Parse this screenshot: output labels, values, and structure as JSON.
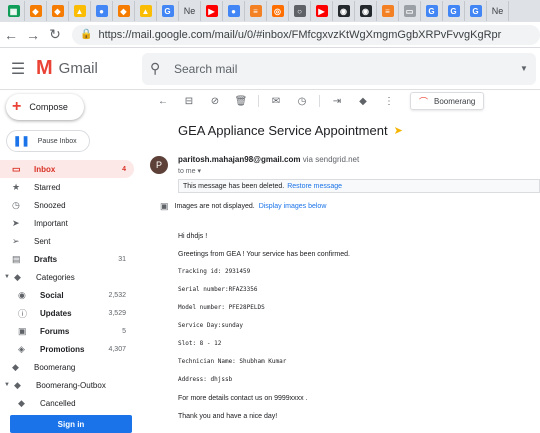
{
  "browser": {
    "tabs": [
      {
        "name": "tab-sheets",
        "glyph": "▦",
        "color": "#0f9d58"
      },
      {
        "name": "tab-orange-1",
        "glyph": "◆",
        "color": "#f57c00"
      },
      {
        "name": "tab-orange-2",
        "glyph": "◆",
        "color": "#f57c00"
      },
      {
        "name": "tab-drive",
        "glyph": "▲",
        "color": "#fbbc04"
      },
      {
        "name": "tab-multi-1",
        "glyph": "●",
        "color": "#4285f4"
      },
      {
        "name": "tab-orange-3",
        "glyph": "◆",
        "color": "#f57c00"
      },
      {
        "name": "tab-drive-2",
        "glyph": "▲",
        "color": "#fbbc04"
      },
      {
        "name": "tab-google-1",
        "glyph": "G",
        "color": "#4285f4"
      },
      {
        "name": "tab-ne-1",
        "glyph": "Ne",
        "color": "#5f6368",
        "is_text": true
      },
      {
        "name": "tab-youtube-1",
        "glyph": "▶",
        "color": "#ff0000"
      },
      {
        "name": "tab-multi-2",
        "glyph": "●",
        "color": "#4285f4"
      },
      {
        "name": "tab-stack",
        "glyph": "≡",
        "color": "#f48024"
      },
      {
        "name": "tab-odd",
        "glyph": "◎",
        "color": "#ff6f00"
      },
      {
        "name": "tab-circle",
        "glyph": "○",
        "color": "#5f6368"
      },
      {
        "name": "tab-youtube-2",
        "glyph": "▶",
        "color": "#ff0000"
      },
      {
        "name": "tab-github-1",
        "glyph": "◉",
        "color": "#24292e"
      },
      {
        "name": "tab-github-2",
        "glyph": "◉",
        "color": "#24292e"
      },
      {
        "name": "tab-stack-2",
        "glyph": "≡",
        "color": "#f48024"
      },
      {
        "name": "tab-gray",
        "glyph": "▭",
        "color": "#9aa0a6"
      },
      {
        "name": "tab-google-2",
        "glyph": "G",
        "color": "#4285f4"
      },
      {
        "name": "tab-google-3",
        "glyph": "G",
        "color": "#4285f4"
      },
      {
        "name": "tab-google-4",
        "glyph": "G",
        "color": "#4285f4"
      },
      {
        "name": "tab-ne-2",
        "glyph": "Ne",
        "color": "#5f6368",
        "is_text": true
      }
    ],
    "url": "https://mail.google.com/mail/u/0/#inbox/FMfcgxvzKtWgXmgmGgbXRPvFvvgKgRpr"
  },
  "gmail": {
    "app_name": "Gmail",
    "search_placeholder": "Search mail"
  },
  "sidebar": {
    "compose_label": "Compose",
    "pause_label": "Pause Inbox",
    "items": [
      {
        "name": "sidebar-item-inbox",
        "icon": "inbox-icon",
        "glyph": "▭",
        "label": "Inbox",
        "count": "4",
        "active": true
      },
      {
        "name": "sidebar-item-starred",
        "icon": "star-icon",
        "glyph": "★",
        "label": "Starred",
        "count": ""
      },
      {
        "name": "sidebar-item-snoozed",
        "icon": "clock-icon",
        "glyph": "◷",
        "label": "Snoozed",
        "count": ""
      },
      {
        "name": "sidebar-item-important",
        "icon": "important-icon",
        "glyph": "➤",
        "label": "Important",
        "count": ""
      },
      {
        "name": "sidebar-item-sent",
        "icon": "send-icon",
        "glyph": "➢",
        "label": "Sent",
        "count": ""
      },
      {
        "name": "sidebar-item-drafts",
        "icon": "draft-icon",
        "glyph": "▤",
        "label": "Drafts",
        "count": "31",
        "bold": true
      },
      {
        "name": "sidebar-item-categories",
        "icon": "label-icon",
        "glyph": "◆",
        "label": "Categories",
        "count": "",
        "caret": true
      },
      {
        "name": "sidebar-item-social",
        "icon": "people-icon",
        "glyph": "◉",
        "label": "Social",
        "count": "2,532",
        "bold": true,
        "sub": true
      },
      {
        "name": "sidebar-item-updates",
        "icon": "info-icon",
        "glyph": "ⓘ",
        "label": "Updates",
        "count": "3,529",
        "bold": true,
        "sub": true
      },
      {
        "name": "sidebar-item-forums",
        "icon": "forum-icon",
        "glyph": "▣",
        "label": "Forums",
        "count": "5",
        "bold": true,
        "sub": true
      },
      {
        "name": "sidebar-item-promotions",
        "icon": "tag-icon",
        "glyph": "◈",
        "label": "Promotions",
        "count": "4,307",
        "bold": true,
        "sub": true
      },
      {
        "name": "sidebar-item-boomerang",
        "icon": "label-icon",
        "glyph": "◆",
        "label": "Boomerang",
        "count": ""
      },
      {
        "name": "sidebar-item-boomerang-outbox",
        "icon": "label-icon",
        "glyph": "◆",
        "label": "Boomerang-Outbox",
        "count": "",
        "caret": true
      },
      {
        "name": "sidebar-item-cancelled",
        "icon": "label-icon",
        "glyph": "◆",
        "label": "Cancelled",
        "count": "",
        "sub": true
      }
    ],
    "signin_label": "Sign in"
  },
  "toolbar": {
    "boomerang_label": "Boomerang"
  },
  "message": {
    "subject": "GEA Appliance Service Appointment",
    "avatar_initial": "P",
    "sender_email": "paritosh.mahajan98@gmail.com",
    "via_text": "via sendgrid.net",
    "to_text": "to me ▾",
    "deleted_notice": "This message has been deleted.",
    "restore_link": "Restore message",
    "images_notice": "Images are not displayed.",
    "images_link": "Display images below",
    "body_lines": [
      {
        "text": "Hi dhdjs !",
        "mono": false
      },
      {
        "text": "Greetings from GEA ! Your service has been confirmed.",
        "mono": false
      },
      {
        "text": "Tracking id: 2931459",
        "mono": true
      },
      {
        "text": "Serial number:RFAZ3356",
        "mono": true
      },
      {
        "text": "Model number: PFE28PELDS",
        "mono": true
      },
      {
        "text": "Service Day:sunday",
        "mono": true
      },
      {
        "text": "Slot: 8 - 12",
        "mono": true
      },
      {
        "text": "Technician Name: Shubham Kumar",
        "mono": true
      },
      {
        "text": "Address: dhjssb",
        "mono": true
      },
      {
        "text": "For more details contact us on 9999xxxx .",
        "mono": false
      },
      {
        "text": "Thank you and have a nice day!",
        "mono": false
      }
    ]
  }
}
